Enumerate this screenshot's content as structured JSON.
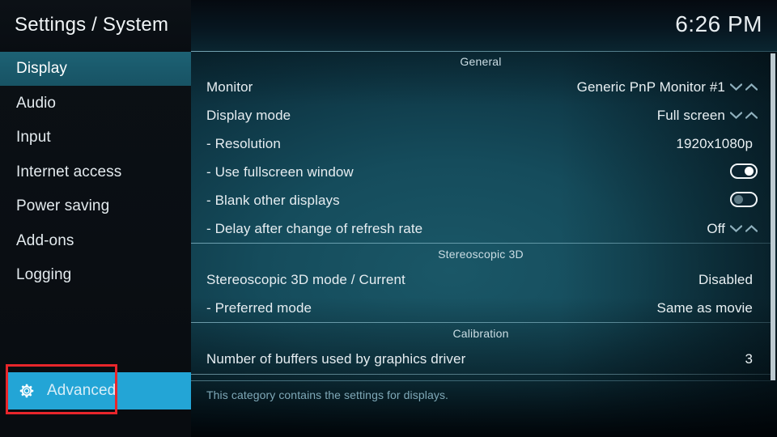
{
  "header": {
    "title": "Settings / System",
    "clock": "6:26 PM"
  },
  "sidebar": {
    "items": [
      {
        "label": "Display",
        "selected": true
      },
      {
        "label": "Audio",
        "selected": false
      },
      {
        "label": "Input",
        "selected": false
      },
      {
        "label": "Internet access",
        "selected": false
      },
      {
        "label": "Power saving",
        "selected": false
      },
      {
        "label": "Add-ons",
        "selected": false
      },
      {
        "label": "Logging",
        "selected": false
      }
    ],
    "advanced": {
      "label": "Advanced",
      "icon": "gear-icon",
      "highlight_color": "#e8262b",
      "background_color": "#23a5d6"
    }
  },
  "content": {
    "sections": [
      {
        "title": "General",
        "rows": [
          {
            "label": "Monitor",
            "value": "Generic PnP Monitor #1",
            "control": "spinner"
          },
          {
            "label": "Display mode",
            "value": "Full screen",
            "control": "spinner"
          },
          {
            "label": "- Resolution",
            "value": "1920x1080p",
            "control": "text"
          },
          {
            "label": "- Use fullscreen window",
            "value": "",
            "control": "toggle-on"
          },
          {
            "label": "- Blank other displays",
            "value": "",
            "control": "toggle-off"
          },
          {
            "label": "- Delay after change of refresh rate",
            "value": "Off",
            "control": "spinner"
          }
        ]
      },
      {
        "title": "Stereoscopic 3D",
        "rows": [
          {
            "label": "Stereoscopic 3D mode / Current",
            "value": "Disabled",
            "control": "text"
          },
          {
            "label": "- Preferred mode",
            "value": "Same as movie",
            "control": "text"
          }
        ]
      },
      {
        "title": "Calibration",
        "rows": [
          {
            "label": "Number of buffers used by graphics driver",
            "value": "3",
            "control": "text"
          }
        ]
      }
    ],
    "description": "This category contains the settings for displays."
  }
}
